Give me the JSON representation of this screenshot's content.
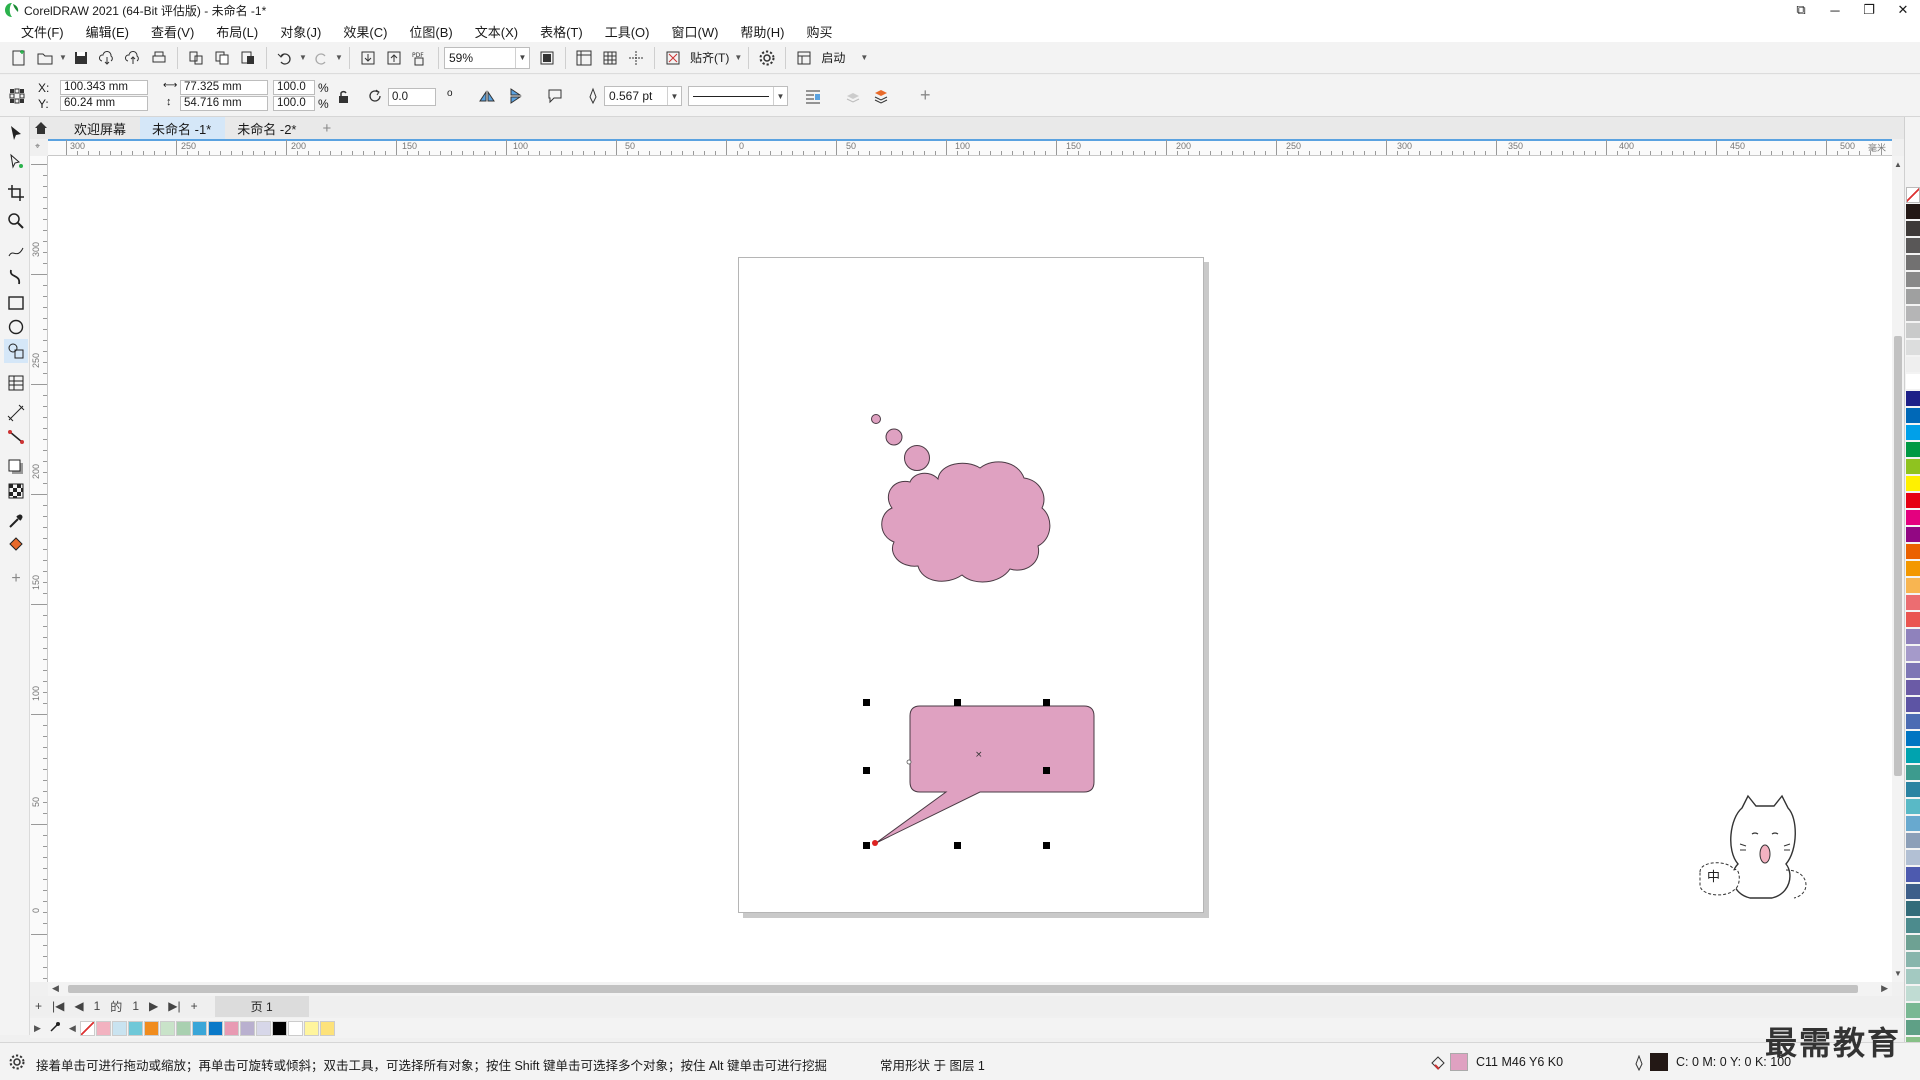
{
  "window": {
    "title": "CorelDRAW 2021 (64-Bit 评估版) - 未命名 -1*"
  },
  "menu": [
    "文件(F)",
    "编辑(E)",
    "查看(V)",
    "布局(L)",
    "对象(J)",
    "效果(C)",
    "位图(B)",
    "文本(X)",
    "表格(T)",
    "工具(O)",
    "窗口(W)",
    "帮助(H)",
    "购买"
  ],
  "toolbar": {
    "zoom": "59%",
    "snap_label": "贴齐(T)",
    "launch_label": "启动"
  },
  "properties": {
    "x_label": "X:",
    "x": "100.343 mm",
    "y_label": "Y:",
    "y": "60.24 mm",
    "width": "77.325 mm",
    "height": "54.716 mm",
    "scale_x": "100.0",
    "scale_y": "100.0",
    "percent": "%",
    "rotation": "0.0",
    "degree": "o",
    "outline_width": "0.567 pt"
  },
  "tabs": [
    "欢迎屏幕",
    "未命名 -1*",
    "未命名 -2*"
  ],
  "ruler": {
    "h_labels": [
      "300",
      "250",
      "200",
      "150",
      "100",
      "50",
      "0",
      "50",
      "100",
      "150",
      "200",
      "250",
      "300",
      "350",
      "400",
      "450",
      "500"
    ],
    "h_unit": "毫米",
    "v_labels": [
      "300",
      "250",
      "200",
      "150",
      "100",
      "50",
      "0"
    ]
  },
  "pagenav": {
    "current": "1",
    "of": "的",
    "total": "1",
    "page_tab": "页 1"
  },
  "status": {
    "hint": "接着单击可进行拖动或缩放；再单击可旋转或倾斜；双击工具，可选择所有对象；按住 Shift 键单击可选择多个对象；按住 Alt 键单击可进行挖掘",
    "object": "常用形状 于 图层 1",
    "fill_value": "C11 M46 Y6 K0",
    "outline_value": "C: 0 M: 0 Y: 0 K: 100"
  },
  "colors": {
    "shape_fill": "#dfa1c1",
    "shape_outline": "#4a3a44",
    "accent": "#5aa2e0"
  },
  "watermark": "最需教育",
  "mascot_text": "中"
}
